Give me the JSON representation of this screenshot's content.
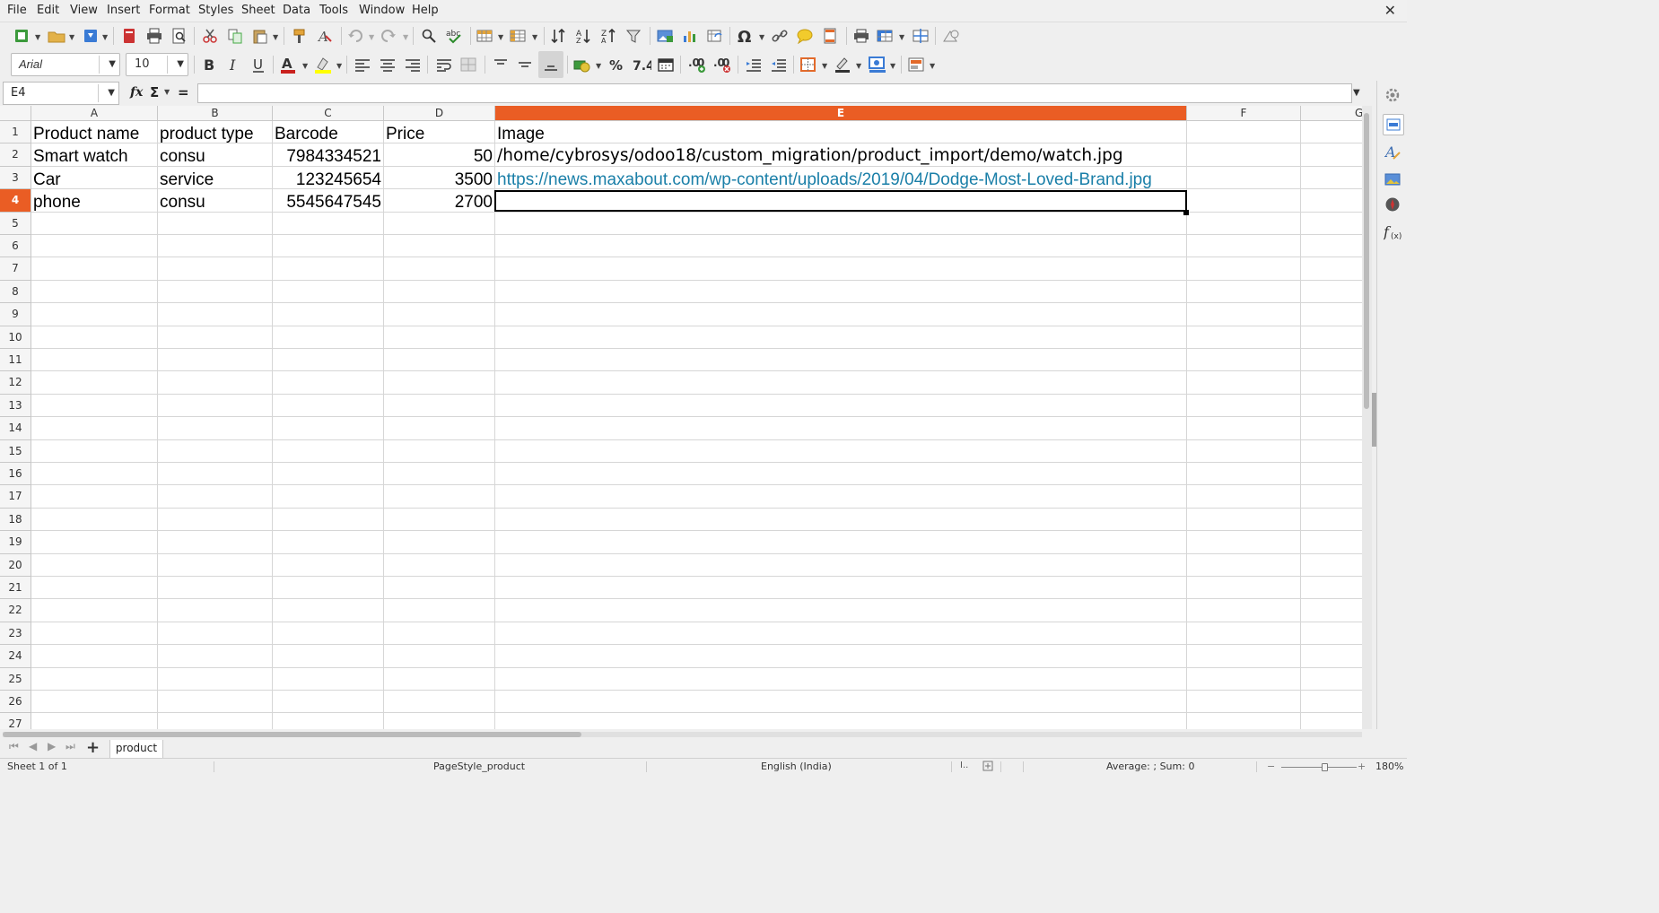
{
  "menus": [
    "File",
    "Edit",
    "View",
    "Insert",
    "Format",
    "Styles",
    "Sheet",
    "Data",
    "Tools",
    "Window",
    "Help"
  ],
  "font": {
    "name": "Arial",
    "size": "10"
  },
  "namebox": {
    "value": "E4"
  },
  "formula": {
    "fx": "fx",
    "sigma": "Σ",
    "equals": "=",
    "value": ""
  },
  "grid": {
    "columns": [
      "A",
      "B",
      "C",
      "D",
      "E",
      "F",
      "G"
    ],
    "rows": [
      "1",
      "2",
      "3",
      "4",
      "5",
      "6",
      "7",
      "8",
      "9",
      "10",
      "11",
      "12",
      "13",
      "14",
      "15",
      "16",
      "17",
      "18",
      "19",
      "20",
      "21",
      "22",
      "23",
      "24",
      "25",
      "26",
      "27"
    ],
    "active_column": "E",
    "active_row": "4",
    "cells": {
      "A1": "Product name",
      "B1": "product type",
      "C1": "Barcode",
      "D1": "Price",
      "E1": "Image",
      "A2": "Smart watch",
      "B2": "consu",
      "C2": "7984334521",
      "D2": "50",
      "E2": "/home/cybrosys/odoo18/custom_migration/product_import/demo/watch.jpg",
      "A3": "Car",
      "B3": "service",
      "C3": "123245654",
      "D3": "3500",
      "E3": "https://news.maxabout.com/wp-content/uploads/2019/04/Dodge-Most-Loved-Brand.jpg",
      "A4": "phone",
      "B4": "consu",
      "C4": "5545647545",
      "D4": "2700"
    },
    "link_color": "#1a7fa8",
    "accent": "#ea5d24"
  },
  "sheet_tabs": [
    "product"
  ],
  "status": {
    "sheet": "Sheet 1 of 1",
    "page_style": "PageStyle_product",
    "language": "English (India)",
    "summary": "Average: ; Sum: 0",
    "zoom": "180%",
    "zoom_minus": "−",
    "zoom_plus": "+"
  }
}
